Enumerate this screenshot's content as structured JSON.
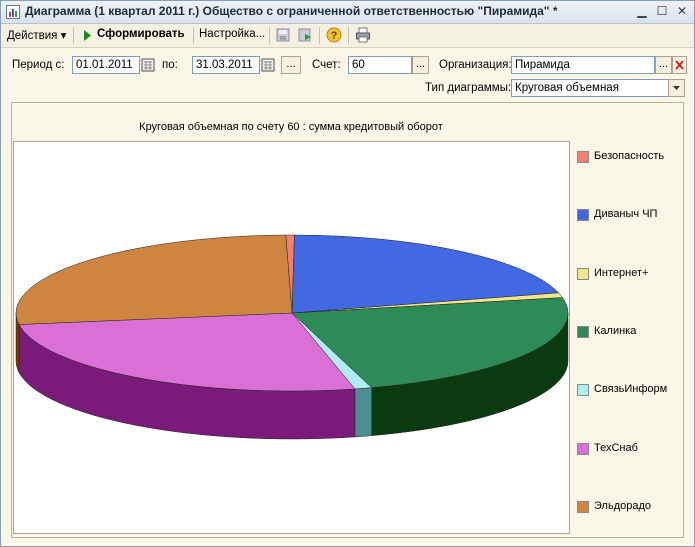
{
  "window": {
    "title": "Диаграмма (1 квартал 2011 г.) Общество с ограниченной ответственностью \"Пирамида\" *"
  },
  "toolbar": {
    "actions_label": "Действия ▾",
    "generate_label": "Сформировать",
    "settings_label": "Настройка..."
  },
  "params": {
    "period_from_label": "Период с:",
    "period_from_value": "01.01.2011",
    "period_to_label": "по:",
    "period_to_value": "31.03.2011",
    "period_button": "...",
    "account_label": "Счет:",
    "account_value": "60",
    "account_button": "...",
    "org_label": "Организация:",
    "org_value": "Пирамида",
    "org_button": "...",
    "chart_type_label": "Тип диаграммы:",
    "chart_type_value": "Круговая объемная"
  },
  "chart_data": {
    "type": "pie",
    "title": "Круговая объемная по счету 60 : сумма кредитовый оборот",
    "legend_position": "right",
    "categories": [
      "Безопасность",
      "Диваныч ЧП",
      "Интернет+",
      "Калинка",
      "СвязьИнформ",
      "ТехСнаб",
      "Эльдорадо"
    ],
    "values": [
      0.5,
      20.7,
      1.0,
      23.5,
      1.0,
      26.3,
      27.0
    ],
    "colors": [
      "#f08070",
      "#4169e1",
      "#f0e68c",
      "#2e8b57",
      "#afeeee",
      "#da70d6",
      "#cd853f"
    ],
    "side_colors": [
      "#8a3a30",
      "#1a2a80",
      "#8a7a20",
      "#0a3a10",
      "#4a9090",
      "#7a1a7a",
      "#7a3a00"
    ]
  }
}
